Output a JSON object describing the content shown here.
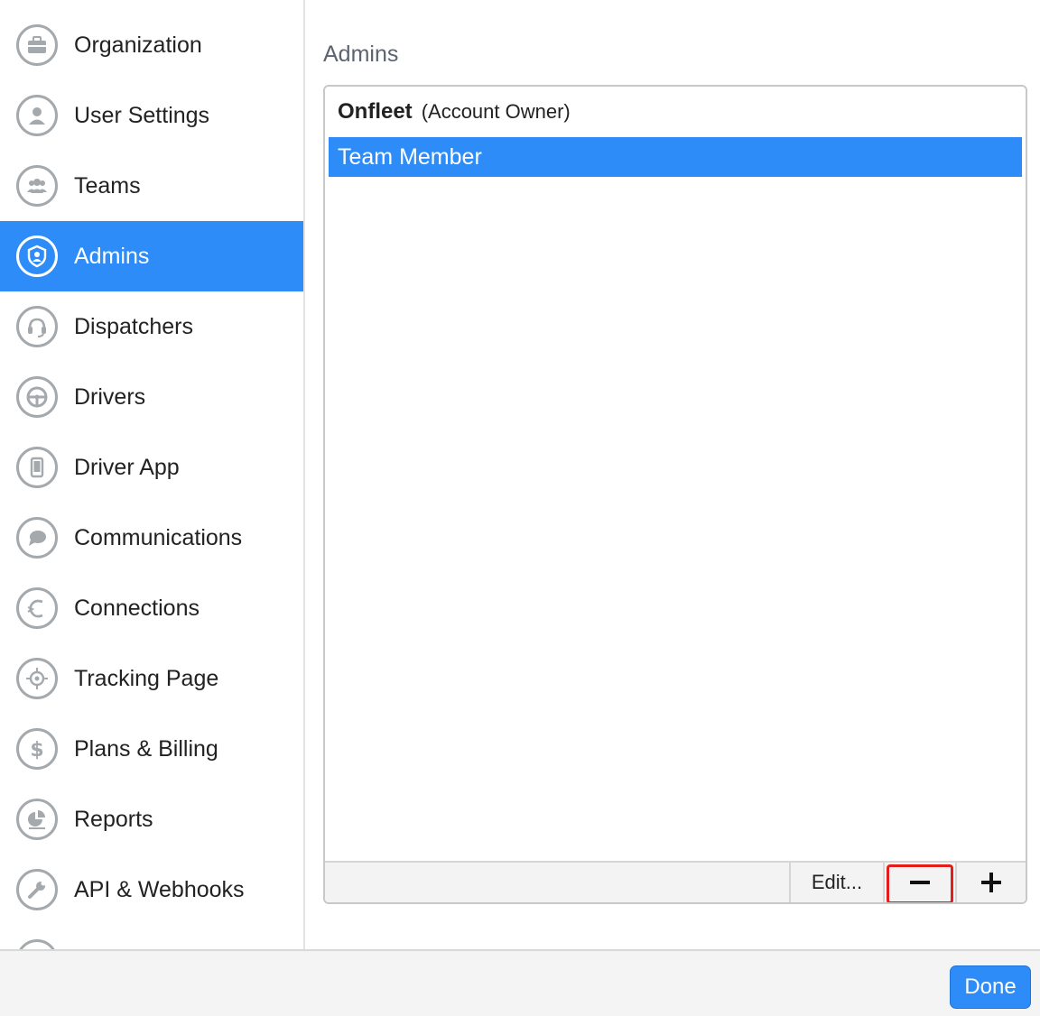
{
  "sidebar": {
    "items": [
      {
        "label": "Organization",
        "icon": "briefcase-icon"
      },
      {
        "label": "User Settings",
        "icon": "user-icon"
      },
      {
        "label": "Teams",
        "icon": "team-icon"
      },
      {
        "label": "Admins",
        "icon": "shield-user-icon",
        "active": true
      },
      {
        "label": "Dispatchers",
        "icon": "headset-icon"
      },
      {
        "label": "Drivers",
        "icon": "steering-wheel-icon"
      },
      {
        "label": "Driver App",
        "icon": "phone-icon"
      },
      {
        "label": "Communications",
        "icon": "chat-bubble-icon"
      },
      {
        "label": "Connections",
        "icon": "connection-icon"
      },
      {
        "label": "Tracking Page",
        "icon": "crosshair-icon"
      },
      {
        "label": "Plans & Billing",
        "icon": "dollar-icon"
      },
      {
        "label": "Reports",
        "icon": "pie-chart-icon"
      },
      {
        "label": "API & Webhooks",
        "icon": "wrench-icon"
      }
    ]
  },
  "main": {
    "title": "Admins",
    "admins": {
      "owner_name": "Onfleet",
      "owner_role": "(Account Owner)",
      "selected_member": "Team Member"
    },
    "footer": {
      "edit_label": "Edit...",
      "remove_label": "−",
      "add_label": "+"
    }
  },
  "bottom": {
    "done_label": "Done"
  },
  "colors": {
    "accent": "#2d8cf7",
    "icon_ring": "#a4a9ad",
    "highlight": "#e51c1c"
  }
}
